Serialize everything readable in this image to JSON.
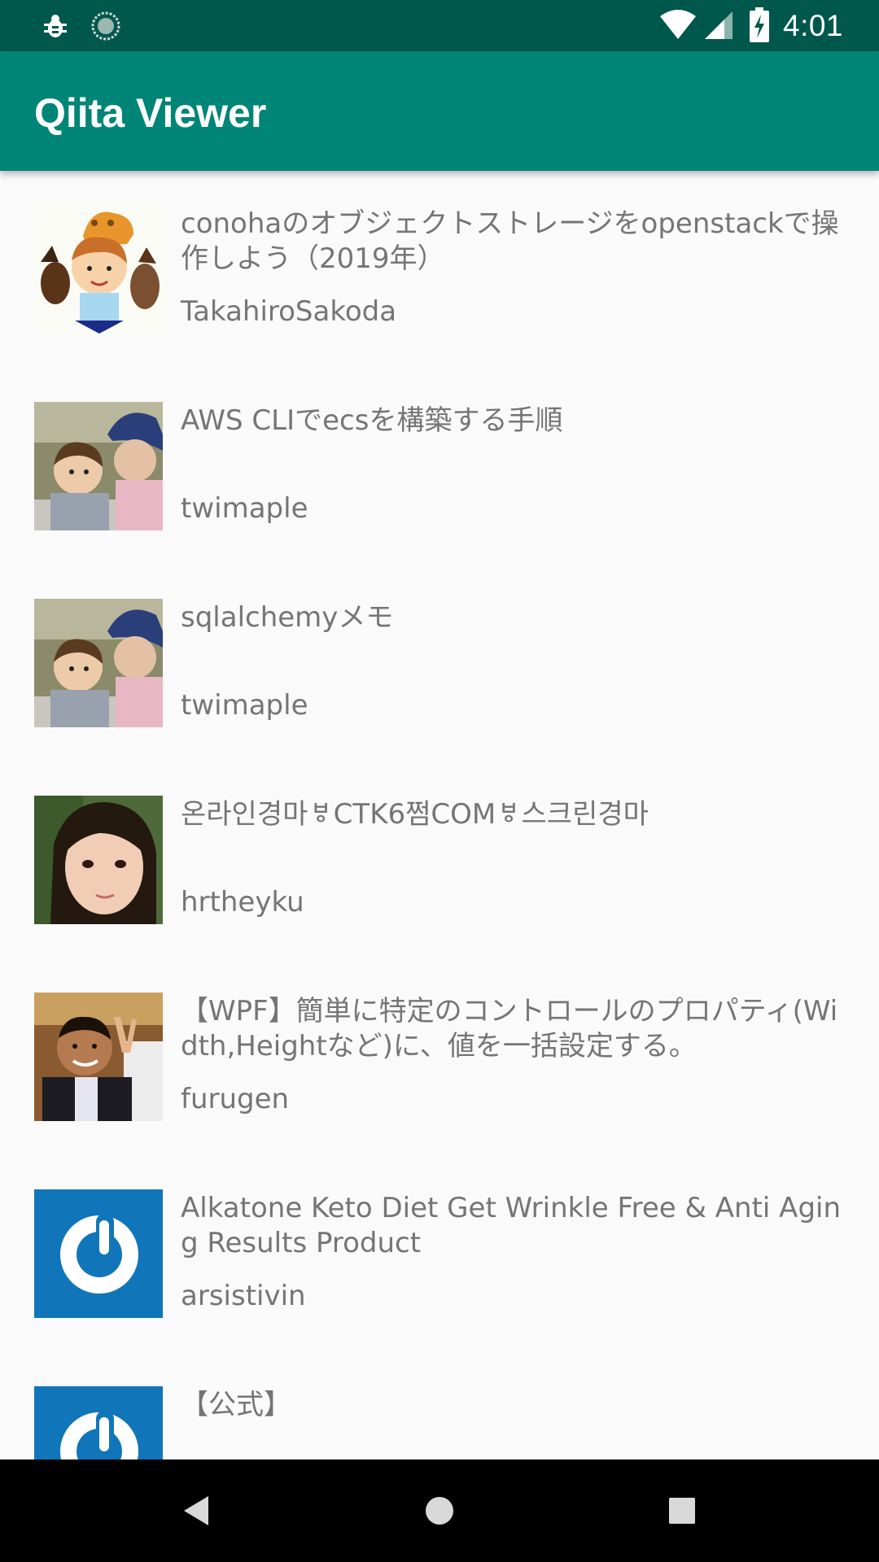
{
  "status_bar": {
    "time": "4:01",
    "left_icons": [
      "debug-icon",
      "sync-icon"
    ],
    "right_icons": [
      "wifi-icon",
      "signal-icon",
      "battery-charging-icon"
    ],
    "background": "#00574b"
  },
  "app_bar": {
    "title": "Qiita Viewer",
    "background": "#008577"
  },
  "articles": [
    {
      "title": "conohaのオブジェクトストレージをopenstackで操作しよう（2019年）",
      "author": "TakahiroSakoda",
      "avatar": "cartoon-family-avatar"
    },
    {
      "title": "AWS CLIでecsを構築する手順",
      "author": "twimaple",
      "avatar": "photo-avatar"
    },
    {
      "title": "sqlalchemyメモ",
      "author": "twimaple",
      "avatar": "photo-avatar"
    },
    {
      "title": "온라인경마ㅸCTK6쩜COMㅸ스크린경마",
      "author": "hrtheyku",
      "avatar": "photo-avatar"
    },
    {
      "title": "【WPF】簡単に特定のコントロールのプロパティ(Width,Heightなど)に、値を一括設定する。",
      "author": "furugen",
      "avatar": "photo-avatar"
    },
    {
      "title": "Alkatone Keto Diet Get Wrinkle Free & Anti Aging Results Product",
      "author": "arsistivin",
      "avatar": "default-avatar"
    },
    {
      "title": "【公式】",
      "author": "",
      "avatar": "default-avatar"
    }
  ],
  "nav_bar": {
    "buttons": [
      "back-icon",
      "home-icon",
      "recents-icon"
    ]
  },
  "colors": {
    "text_secondary": "#757575",
    "list_background": "#fafafa",
    "default_avatar_blue": "#1176b9"
  }
}
